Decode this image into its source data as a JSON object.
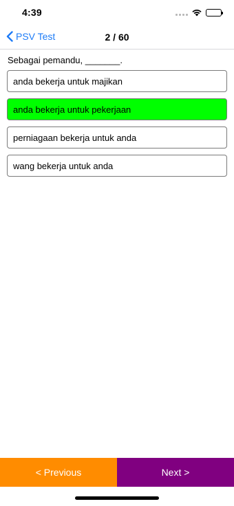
{
  "status_bar": {
    "time": "4:39",
    "icons": [
      "cellular-signal-icon",
      "wifi-icon",
      "battery-icon"
    ]
  },
  "nav": {
    "back_label": "PSV Test",
    "title": "2 / 60",
    "accent_color": "#1e7cf7"
  },
  "question": {
    "text": "Sebagai pemandu, _______."
  },
  "answers": [
    {
      "label": "anda bekerja untuk majikan",
      "state": "default"
    },
    {
      "label": "anda bekerja untuk pekerjaan",
      "state": "correct",
      "highlight_color": "#00ff00"
    },
    {
      "label": "perniagaan bekerja untuk anda",
      "state": "default"
    },
    {
      "label": "wang bekerja untuk anda",
      "state": "default"
    }
  ],
  "bottom_bar": {
    "previous_label": "< Previous",
    "previous_color": "#ff8c00",
    "next_label": "Next >",
    "next_color": "#800080"
  }
}
